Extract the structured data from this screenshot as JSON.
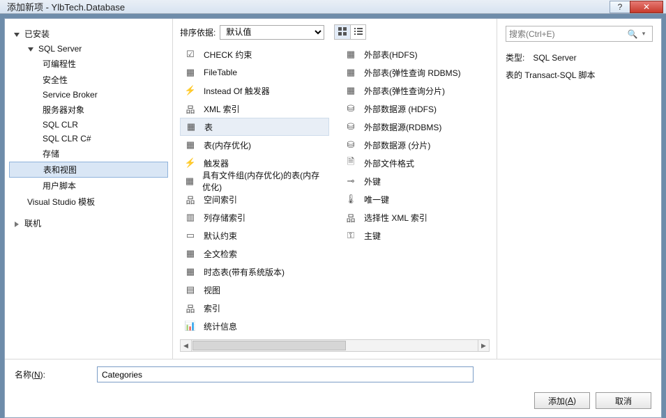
{
  "window": {
    "title": "添加新项 - YlbTech.Database",
    "help_glyph": "?",
    "close_glyph": "✕"
  },
  "tree": {
    "installed": "已安装",
    "sql_server": "SQL Server",
    "programmability": "可编程性",
    "security": "安全性",
    "service_broker": "Service Broker",
    "server_objects": "服务器对象",
    "sql_clr": "SQL CLR",
    "sql_clr_cs": "SQL CLR C#",
    "storage": "存储",
    "tables_views": "表和视图",
    "user_scripts": "用户脚本",
    "vs_templates": "Visual Studio 模板",
    "online": "联机"
  },
  "toolbar": {
    "sort_label": "排序依据:",
    "sort_value": "默认值"
  },
  "items_col1": {
    "check": "CHECK 约束",
    "filetable": "FileTable",
    "insteadof": "Instead Of 触发器",
    "xmlidx": "XML 索引",
    "table": "表",
    "table_mem": "表(内存优化)",
    "trigger": "触发器",
    "filegroup_mem": "具有文件组(内存优化)的表(内存优化)",
    "spatial": "空间索引",
    "colstore": "列存储索引",
    "default": "默认约束",
    "fulltext": "全文检索",
    "temporal": "时态表(带有系统版本)",
    "view": "视图",
    "index": "索引",
    "stats": "统计信息"
  },
  "items_col2": {
    "ext_hdfs": "外部表(HDFS)",
    "ext_rdbms": "外部表(弹性查询 RDBMS)",
    "ext_shard": "外部表(弹性查询分片)",
    "ds_hdfs": "外部数据源 (HDFS)",
    "ds_rdbms": "外部数据源(RDBMS)",
    "ds_shard": "外部数据源 (分片)",
    "fileformat": "外部文件格式",
    "fk": "外键",
    "unique": "唯一键",
    "selxml": "选择性 XML 索引",
    "pk": "主键"
  },
  "search": {
    "placeholder": "搜索(Ctrl+E)"
  },
  "info": {
    "type_label": "类型:",
    "type_value": "SQL Server",
    "desc": "表的 Transact-SQL 脚本"
  },
  "bottom": {
    "name_label_prefix": "名称(",
    "name_label_key": "N",
    "name_label_suffix": "):",
    "name_value": "Categories",
    "add_prefix": "添加(",
    "add_key": "A",
    "add_suffix": ")",
    "cancel": "取消"
  }
}
